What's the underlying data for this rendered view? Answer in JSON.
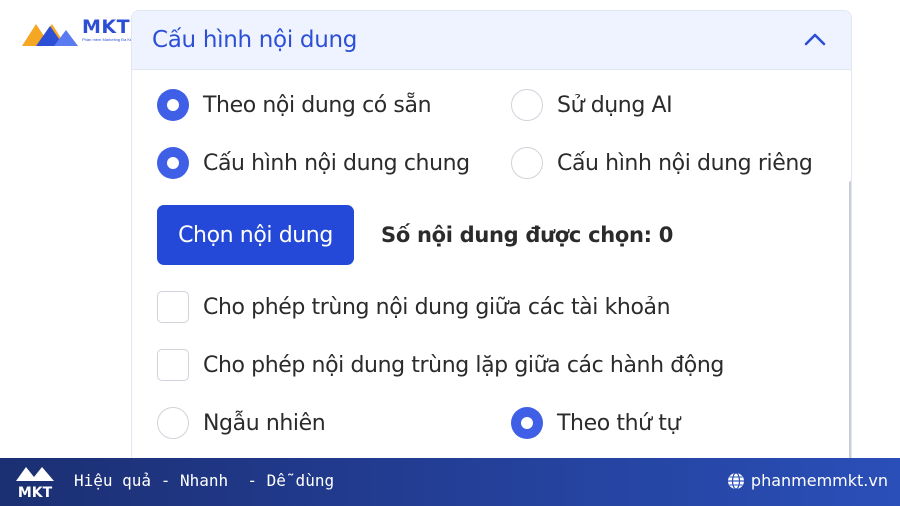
{
  "brand": {
    "logo_word": "MKT",
    "logo_tagline": "Phần mềm Marketing Đa Kênh",
    "accent": "#2d4fd6",
    "button_color": "#2449d8",
    "radio_on_color": "#3f5fe6"
  },
  "panel": {
    "title": "Cấu hình nội dung",
    "collapse_icon": "chevron-up-icon"
  },
  "options": {
    "source_available": {
      "label": "Theo nội dung có sẵn",
      "selected": true
    },
    "source_ai": {
      "label": "Sử dụng AI",
      "selected": false
    },
    "config_common": {
      "label": "Cấu hình nội dung chung",
      "selected": true
    },
    "config_private": {
      "label": "Cấu hình nội dung riêng",
      "selected": false
    },
    "allow_dup_accounts": {
      "label": "Cho phép trùng nội dung giữa các tài khoản",
      "checked": false
    },
    "allow_dup_actions": {
      "label": "Cho phép nội dung trùng lặp giữa các hành động",
      "checked": false
    },
    "order_random": {
      "label": "Ngẫu nhiên",
      "selected": false
    },
    "order_sequential": {
      "label": "Theo thứ tự",
      "selected": true
    }
  },
  "content_picker": {
    "button_label": "Chọn nội dung",
    "selected_count_text": "Số nội dung được chọn: 0"
  },
  "footer": {
    "logo_word": "MKT",
    "slogan": "Hiệu quả - Nhanh  - Dễ dùng",
    "website": "phanmemmkt.vn",
    "globe_icon": "globe-icon"
  }
}
